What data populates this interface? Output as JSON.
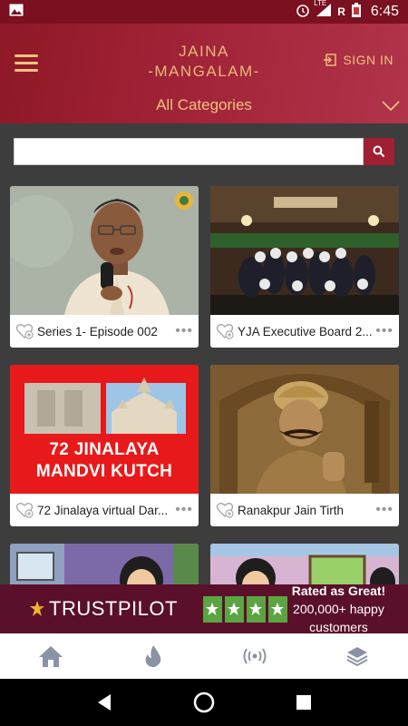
{
  "status_bar": {
    "time": "6:45",
    "network_label": "LTE",
    "roaming_label": "R",
    "icons": [
      "image-icon",
      "alarm-icon",
      "signal-icon",
      "battery-icon"
    ]
  },
  "header": {
    "brand_line1": "JAINA",
    "brand_line2": "-MANGALAM-",
    "signin_label": "SIGN IN",
    "category_label": "All Categories",
    "accent_color": "#f2c27e",
    "bg_color": "#9b1f33"
  },
  "search": {
    "value": "",
    "placeholder": ""
  },
  "cards": [
    {
      "title": "Series 1- Episode 002",
      "thumb": "man-speaking-microphone"
    },
    {
      "title": "YJA Executive Board 2...",
      "thumb": "group-photo-holding-numbers"
    },
    {
      "title": "72 Jinalaya virtual Dar...",
      "thumb": "temple-poster",
      "poster_line1": "72 JINALAYA",
      "poster_line2": "MANDVI KUTCH"
    },
    {
      "title": "Ranakpur Jain Tirth",
      "thumb": "sepia-illustration-king"
    },
    {
      "title": "",
      "thumb": "cartoon-girl"
    },
    {
      "title": "",
      "thumb": "cartoon-characters"
    }
  ],
  "ad": {
    "brand": "TRUSTPILOT",
    "line1": "Rated as Great!",
    "line2": "200,000+ happy customers",
    "star_color": "#5aa541",
    "bg_color": "#5a0f2a"
  },
  "bottom_nav": [
    {
      "name": "home",
      "icon": "home-icon"
    },
    {
      "name": "trending",
      "icon": "flame-icon"
    },
    {
      "name": "live",
      "icon": "broadcast-icon"
    },
    {
      "name": "categories",
      "icon": "layers-icon"
    }
  ]
}
